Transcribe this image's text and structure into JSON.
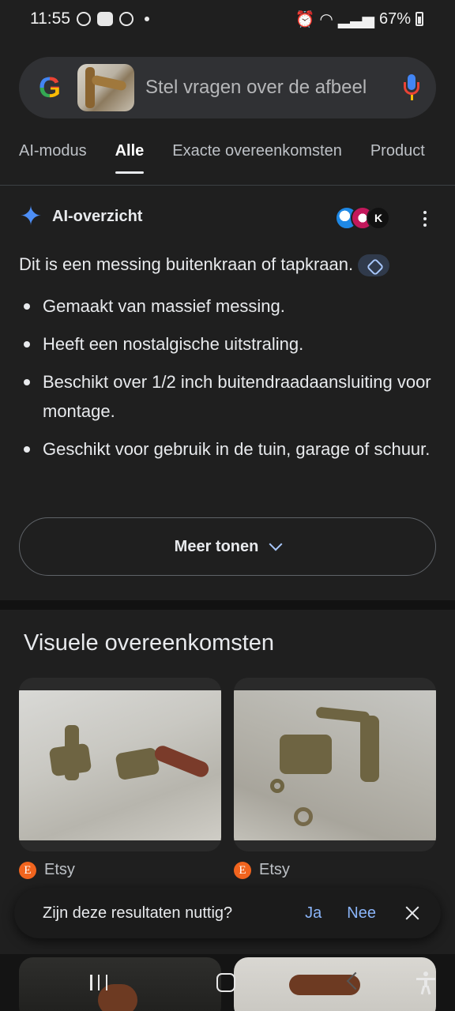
{
  "status_bar": {
    "time": "11:55",
    "battery": "67%"
  },
  "search": {
    "placeholder": "Stel vragen over de afbeel"
  },
  "tabs": [
    {
      "label": "AI-modus",
      "active": false
    },
    {
      "label": "Alle",
      "active": true
    },
    {
      "label": "Exacte overeenkomsten",
      "active": false
    },
    {
      "label": "Product",
      "active": false
    }
  ],
  "ai_overview": {
    "title": "AI-overzicht",
    "summary": "Dit is een messing buitenkraan of tapkraan.",
    "bullets": [
      "Gemaakt van massief messing.",
      "Heeft een nostalgische uitstraling.",
      "Beschikt over 1/2 inch buitendraadaansluiting voor montage.",
      "Geschikt voor gebruik in de tuin, garage of schuur."
    ],
    "show_more_label": "Meer tonen"
  },
  "visual_matches": {
    "title": "Visuele overeenkomsten",
    "results": [
      {
        "source": "Etsy",
        "source_icon": "E"
      },
      {
        "source": "Etsy",
        "source_icon": "E"
      }
    ]
  },
  "feedback": {
    "question": "Zijn deze resultaten nuttig?",
    "yes_label": "Ja",
    "no_label": "Nee"
  },
  "colors": {
    "background": "#1f1f1f",
    "link_blue": "#8ab4f8",
    "etsy_orange": "#f1641e",
    "ai_sparkle": "#4d8ef5"
  }
}
